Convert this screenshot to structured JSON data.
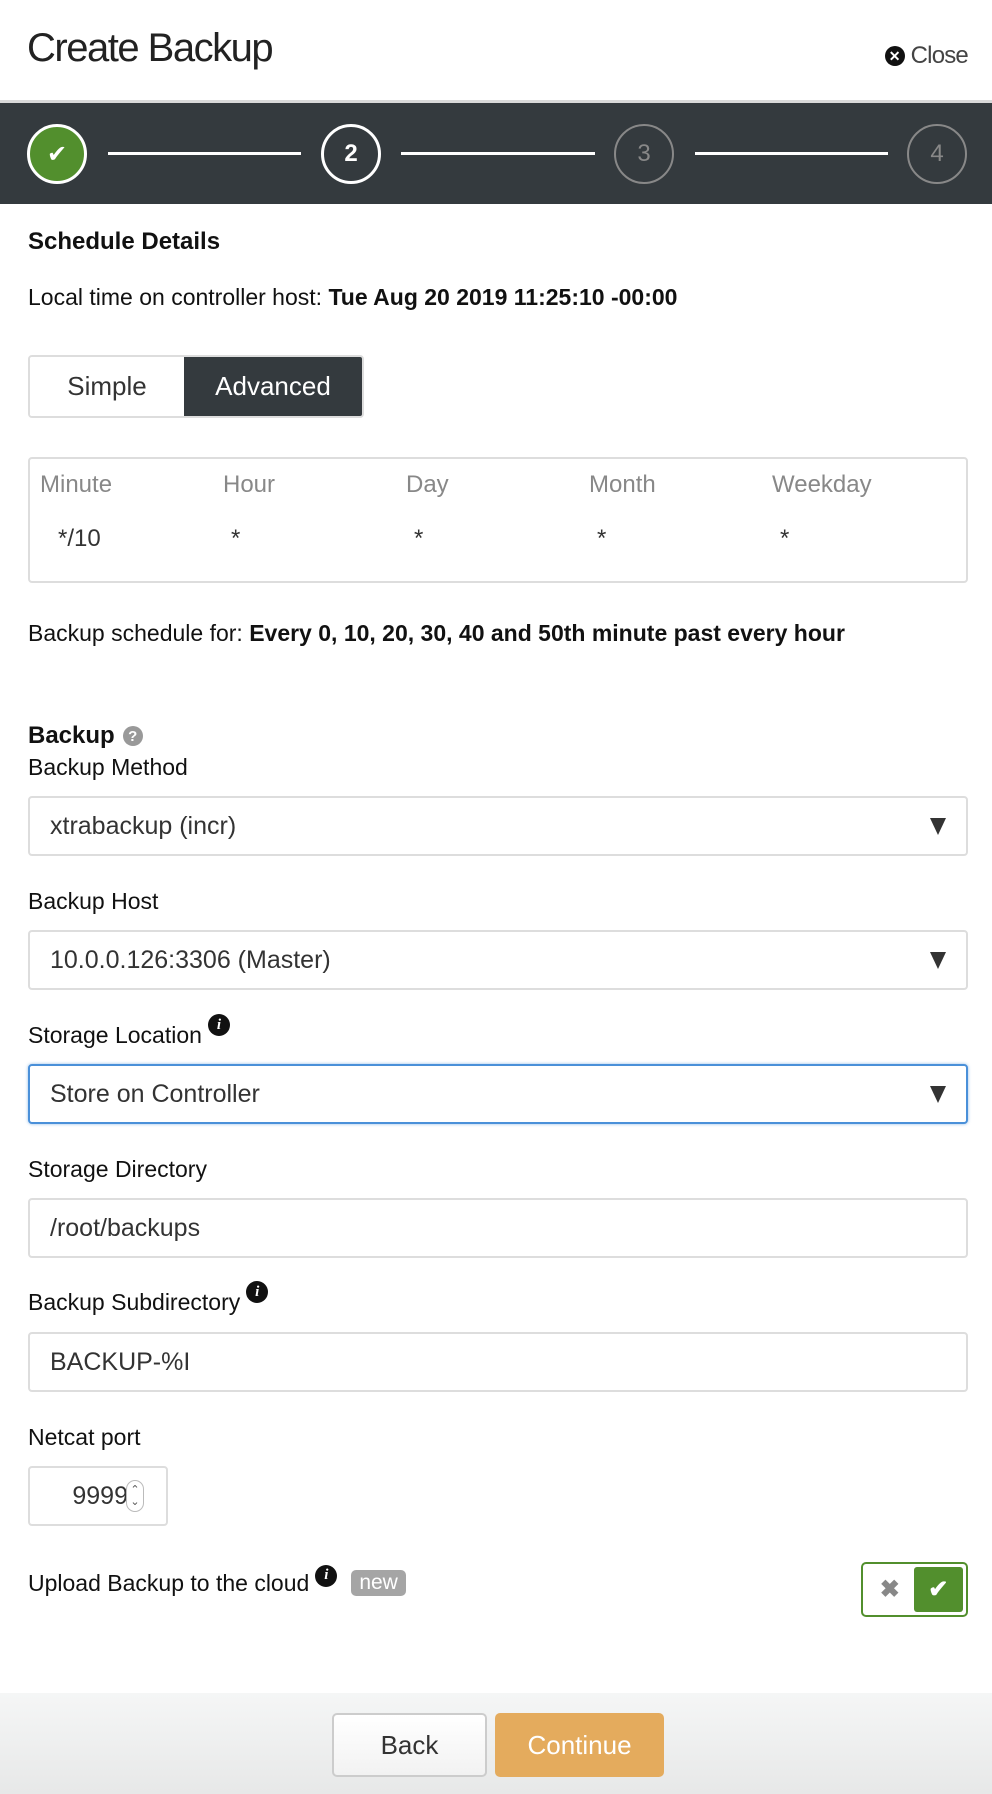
{
  "header": {
    "title": "Create Backup",
    "close_label": "Close",
    "close_icon": "times-circle-icon"
  },
  "wizard": {
    "steps": [
      {
        "label": "✔",
        "state": "done"
      },
      {
        "label": "2",
        "state": "active"
      },
      {
        "label": "3",
        "state": "pending"
      },
      {
        "label": "4",
        "state": "pending"
      }
    ]
  },
  "schedule": {
    "title": "Schedule Details",
    "local_time_label": "Local time on controller host: ",
    "local_time_value": "Tue Aug 20 2019 11:25:10 -00:00",
    "mode_options": [
      "Simple",
      "Advanced"
    ],
    "mode_selected": "Advanced",
    "cron": {
      "minute_label": "Minute",
      "minute_value": "*/10",
      "hour_label": "Hour",
      "hour_value": "*",
      "day_label": "Day",
      "day_value": "*",
      "month_label": "Month",
      "month_value": "*",
      "weekday_label": "Weekday",
      "weekday_value": "*"
    },
    "schedule_for_label": "Backup schedule for: ",
    "schedule_for_value": "Every 0, 10, 20, 30, 40 and 50th minute past every hour"
  },
  "backup": {
    "title": "Backup",
    "help_icon": "?",
    "method_label": "Backup Method",
    "method_value": "xtrabackup (incr)",
    "host_label": "Backup Host",
    "host_value": "10.0.0.126:3306 (Master)",
    "storage_location_label": "Storage Location",
    "storage_location_value": "Store on Controller",
    "storage_directory_label": "Storage Directory",
    "storage_directory_value": "/root/backups",
    "subdirectory_label": "Backup Subdirectory",
    "subdirectory_value": "BACKUP-%I",
    "netcat_label": "Netcat port",
    "netcat_value": "9999",
    "upload_label": "Upload Backup to the cloud",
    "upload_badge": "new",
    "upload_enabled": true,
    "info_icon": "i"
  },
  "footer": {
    "back_label": "Back",
    "continue_label": "Continue"
  },
  "colors": {
    "wizard_bg": "#343a3e",
    "success_green": "#528f2d",
    "continue_orange": "#e4ab5d",
    "focus_blue": "#4a90d9"
  }
}
